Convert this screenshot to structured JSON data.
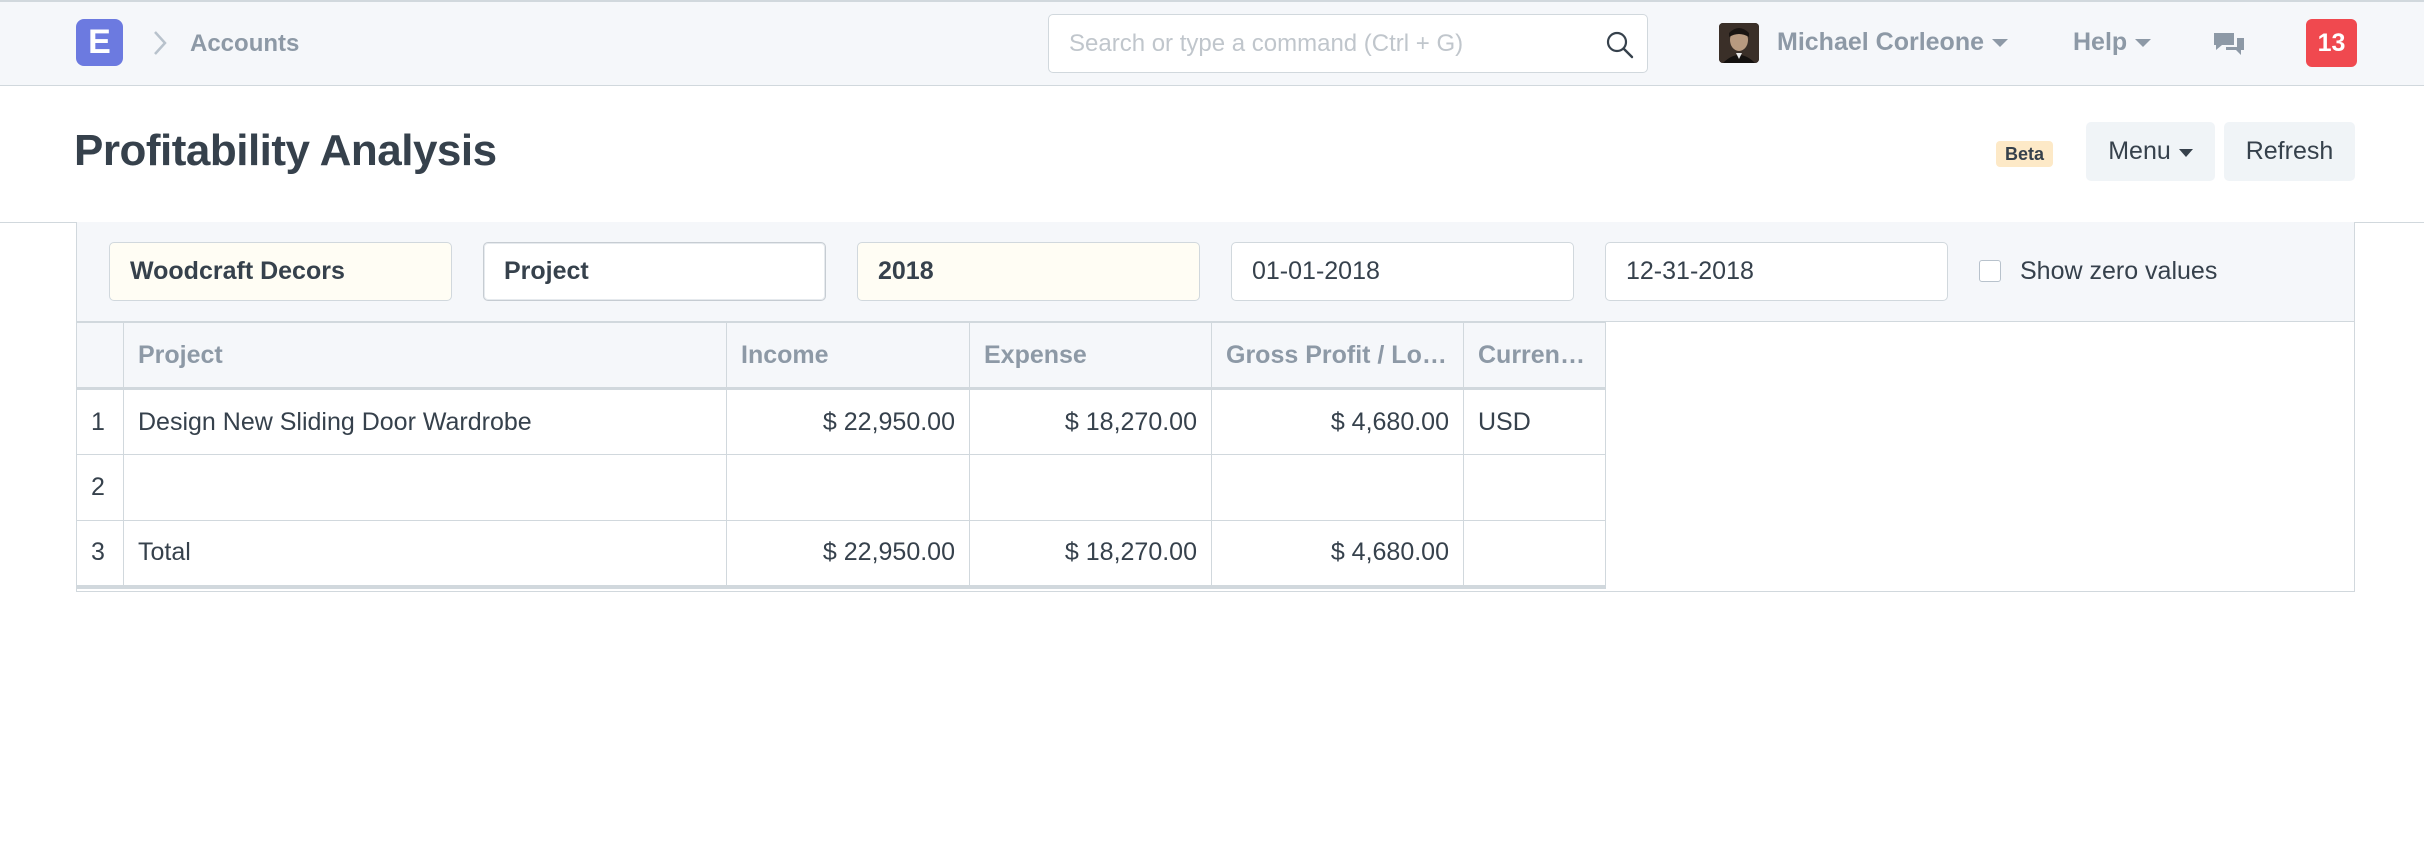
{
  "navbar": {
    "brand_letter": "E",
    "breadcrumb": "Accounts",
    "search_placeholder": "Search or type a command (Ctrl + G)",
    "user_name": "Michael Corleone",
    "help_label": "Help",
    "notification_count": "13"
  },
  "page": {
    "title": "Profitability Analysis",
    "beta_label": "Beta",
    "menu_label": "Menu",
    "refresh_label": "Refresh"
  },
  "filters": {
    "company": "Woodcraft Decors",
    "based_on": "Project",
    "fiscal_year": "2018",
    "from_date": "01-01-2018",
    "to_date": "12-31-2018",
    "show_zero_label": "Show zero values",
    "show_zero_checked": false
  },
  "table": {
    "columns": [
      "Project",
      "Income",
      "Expense",
      "Gross Profit / Lo…",
      "Curren…"
    ],
    "rows": [
      {
        "index": "1",
        "project": "Design New Sliding Door Wardrobe",
        "income": "$ 22,950.00",
        "expense": "$ 18,270.00",
        "gross_profit": "$ 4,680.00",
        "currency": "USD"
      },
      {
        "index": "2",
        "project": "",
        "income": "",
        "expense": "",
        "gross_profit": "",
        "currency": ""
      },
      {
        "index": "3",
        "project": "Total",
        "income": "$ 22,950.00",
        "expense": "$ 18,270.00",
        "gross_profit": "$ 4,680.00",
        "currency": ""
      }
    ]
  },
  "colors": {
    "brand": "#6c7ae0",
    "notification": "#f0494f",
    "beta_badge": "#fde9c7"
  }
}
